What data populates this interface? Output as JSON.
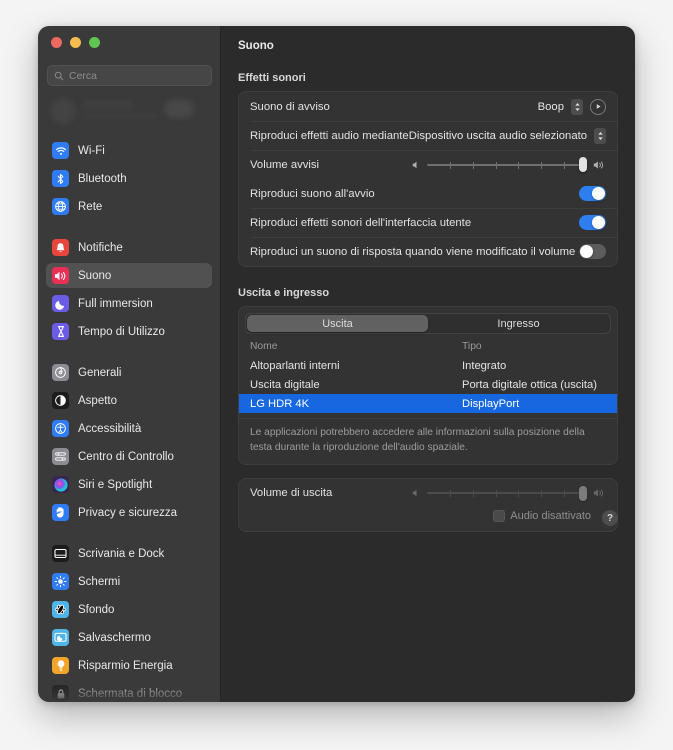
{
  "window": {
    "title": "Suono",
    "traffic_lights": [
      "close-red",
      "minimize-yellow",
      "zoom-green"
    ]
  },
  "sidebar": {
    "search": {
      "placeholder": "Cerca",
      "value": "",
      "icon": "search-icon"
    },
    "groups": [
      {
        "items": [
          {
            "label": "Wi-Fi",
            "icon": "wifi-icon",
            "color": "#2f7cf6",
            "active": false
          },
          {
            "label": "Bluetooth",
            "icon": "bluetooth-icon",
            "color": "#2f7cf6",
            "active": false
          },
          {
            "label": "Rete",
            "icon": "network-globe-icon",
            "color": "#2f7cf6",
            "active": false
          }
        ]
      },
      {
        "items": [
          {
            "label": "Notifiche",
            "icon": "notifications-bell-icon",
            "color": "#e8453c",
            "active": false
          },
          {
            "label": "Suono",
            "icon": "sound-speaker-icon",
            "color": "#ea2f56",
            "active": true
          },
          {
            "label": "Full immersion",
            "icon": "focus-moon-icon",
            "color": "#6b5ce7",
            "active": false
          },
          {
            "label": "Tempo di Utilizzo",
            "icon": "screen-time-hourglass-icon",
            "color": "#6b5ce7",
            "active": false
          }
        ]
      },
      {
        "items": [
          {
            "label": "Generali",
            "icon": "general-gear-icon",
            "color": "#8c8c93",
            "active": false
          },
          {
            "label": "Aspetto",
            "icon": "appearance-contrast-icon",
            "color": "#1c1c1e",
            "active": false
          },
          {
            "label": "Accessibilità",
            "icon": "accessibility-icon",
            "color": "#2f7cf6",
            "active": false
          },
          {
            "label": "Centro di Controllo",
            "icon": "control-center-icon",
            "color": "#8c8c93",
            "active": false
          },
          {
            "label": "Siri e Spotlight",
            "icon": "siri-icon",
            "color": "#3a2550",
            "active": false
          },
          {
            "label": "Privacy e sicurezza",
            "icon": "privacy-hand-icon",
            "color": "#2f7cf6",
            "active": false
          }
        ]
      },
      {
        "items": [
          {
            "label": "Scrivania e Dock",
            "icon": "desktop-dock-icon",
            "color": "#1c1c1e",
            "active": false
          },
          {
            "label": "Schermi",
            "icon": "displays-brightness-icon",
            "color": "#2f7cf6",
            "active": false
          },
          {
            "label": "Sfondo",
            "icon": "wallpaper-icon",
            "color": "#4fb4e8",
            "active": false
          },
          {
            "label": "Salvaschermo",
            "icon": "screensaver-icon",
            "color": "#4fb4e8",
            "active": false
          },
          {
            "label": "Risparmio Energia",
            "icon": "energy-saver-bulb-icon",
            "color": "#f0a52a",
            "active": false
          },
          {
            "label": "Schermata di blocco",
            "icon": "lock-screen-icon",
            "color": "#1c1c1e",
            "active": false
          }
        ]
      }
    ]
  },
  "main": {
    "sound_effects": {
      "section_title": "Effetti sonori",
      "alert_sound": {
        "label": "Suono di avviso",
        "value": "Boop",
        "stepper_icon": "chevron-up-down-icon",
        "play_icon": "play-icon"
      },
      "play_through": {
        "label": "Riproduci effetti audio mediante",
        "value": "Dispositivo uscita audio selezionato",
        "stepper_icon": "chevron-up-down-icon"
      },
      "alert_volume": {
        "label": "Volume avvisi",
        "value": 100,
        "min": 0,
        "max": 100,
        "ticks": 6,
        "left_icon": "speaker-low-icon",
        "right_icon": "speaker-high-icon"
      },
      "toggles": [
        {
          "label": "Riproduci suono all'avvio",
          "on": true
        },
        {
          "label": "Riproduci effetti sonori dell'interfaccia utente",
          "on": true
        },
        {
          "label": "Riproduci un suono di risposta quando viene modificato il volume",
          "on": false
        }
      ]
    },
    "output_input": {
      "section_title": "Uscita e ingresso",
      "segments": [
        {
          "label": "Uscita",
          "active": true
        },
        {
          "label": "Ingresso",
          "active": false
        }
      ],
      "table": {
        "columns": [
          "Nome",
          "Tipo"
        ],
        "rows": [
          {
            "name": "Altoparlanti interni",
            "type": "Integrato",
            "selected": false
          },
          {
            "name": "Uscita digitale",
            "type": "Porta digitale ottica (uscita)",
            "selected": false
          },
          {
            "name": "LG HDR 4K",
            "type": "DisplayPort",
            "selected": true
          }
        ]
      },
      "note": "Le applicazioni potrebbero accedere alle informazioni sulla posizione della testa durante la riproduzione dell'audio spaziale."
    },
    "output_volume": {
      "label": "Volume di uscita",
      "value": 100,
      "min": 0,
      "max": 100,
      "ticks": 6,
      "left_icon": "speaker-low-icon",
      "right_icon": "speaker-high-icon",
      "disabled": true,
      "mute": {
        "label": "Audio disattivato",
        "checked": false,
        "disabled": true
      }
    },
    "help_button": {
      "label": "?",
      "icon": "help-question-icon"
    }
  },
  "colors": {
    "accent_blue": "#1667e0",
    "toggle_on": "#2d7ff0",
    "window_bg": "#2b2b2b",
    "sidebar_bg": "#3a3a3a",
    "card_bg": "#333333"
  }
}
